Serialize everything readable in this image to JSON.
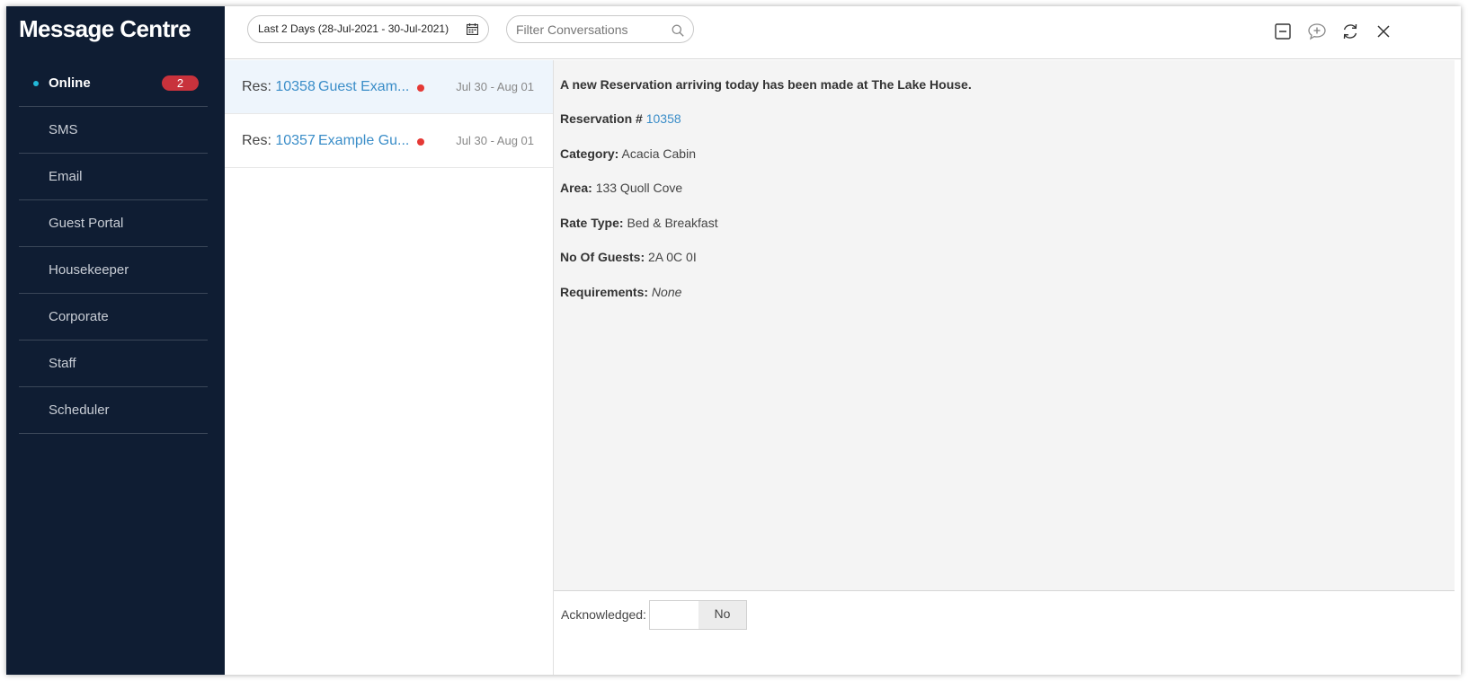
{
  "sidebar": {
    "title": "Message Centre",
    "items": [
      {
        "label": "Online",
        "badge": "2"
      },
      {
        "label": "SMS"
      },
      {
        "label": "Email"
      },
      {
        "label": "Guest Portal"
      },
      {
        "label": "Housekeeper"
      },
      {
        "label": "Corporate"
      },
      {
        "label": "Staff"
      },
      {
        "label": "Scheduler"
      }
    ]
  },
  "toolbar": {
    "date_range": "Last 2 Days (28-Jul-2021 - 30-Jul-2021)",
    "filter_placeholder": "Filter Conversations",
    "icons": [
      "minimize-icon",
      "new-message-icon",
      "refresh-icon",
      "close-icon"
    ]
  },
  "conversations": [
    {
      "prefix": "Res:",
      "res_no": "10358",
      "guest": "Guest Exam...",
      "dates": "Jul 30 - Aug 01"
    },
    {
      "prefix": "Res:",
      "res_no": "10357",
      "guest": "Example Gu...",
      "dates": "Jul 30 - Aug 01"
    }
  ],
  "detail": {
    "headline": "A new Reservation arriving today has been made at The Lake House.",
    "reservation_label": "Reservation #",
    "reservation_no": "10358",
    "category_label": "Category:",
    "category": "Acacia Cabin",
    "area_label": "Area:",
    "area": "133 Quoll Cove",
    "rate_type_label": "Rate Type:",
    "rate_type": "Bed & Breakfast",
    "guests_label": "No Of Guests:",
    "guests": "2A 0C 0I",
    "requirements_label": "Requirements:",
    "requirements": "None"
  },
  "acknowledged": {
    "label": "Acknowledged:",
    "value": "No"
  },
  "colors": {
    "sidebar_bg": "#0f1d33",
    "accent_link": "#3a8dc8",
    "badge": "#c8323c",
    "unread_dot": "#e53935",
    "online_dot": "#22b8d8"
  }
}
